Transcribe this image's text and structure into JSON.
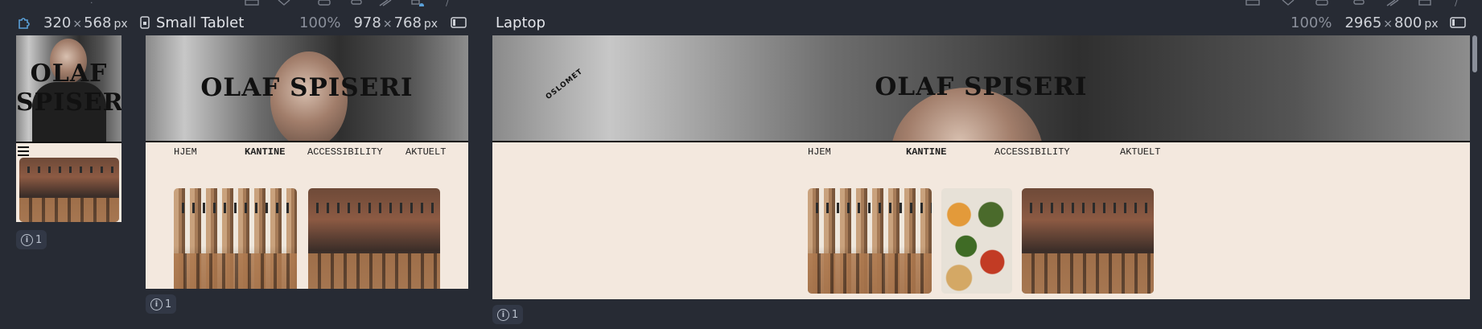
{
  "devices": [
    {
      "name": "",
      "zoom": "",
      "width": "320",
      "height": "568",
      "unit": "px",
      "site": {
        "title": "OLAF SPISERI",
        "title_line1": "OLAF",
        "title_line2": "SPISERI",
        "menu_icon": "hamburger-icon"
      },
      "info_count": "1"
    },
    {
      "name": "Small Tablet",
      "zoom": "100%",
      "width": "978",
      "height": "768",
      "unit": "px",
      "site": {
        "title": "OLAF SPISERI",
        "nav": [
          "HJEM",
          "KANTINE",
          "ACCESSIBILITY",
          "AKTUELT"
        ],
        "active": "KANTINE"
      },
      "info_count": "1"
    },
    {
      "name": "Laptop",
      "zoom": "100%",
      "width": "2965",
      "height": "800",
      "unit": "px",
      "site": {
        "title": "OLAF SPISERI",
        "logo": "OSLOMET",
        "nav": [
          "HJEM",
          "KANTINE",
          "ACCESSIBILITY",
          "AKTUELT"
        ],
        "active": "KANTINE"
      },
      "info_count": "1"
    }
  ],
  "times": "×",
  "icons": {
    "plugin": "puzzle-icon",
    "rotate": "rotate-icon",
    "viewport": "viewport-toggle-icon",
    "info": "info-icon"
  },
  "colors": {
    "background": "#272b34",
    "page": "#f3e8de",
    "accent": "#5aa0d8"
  }
}
